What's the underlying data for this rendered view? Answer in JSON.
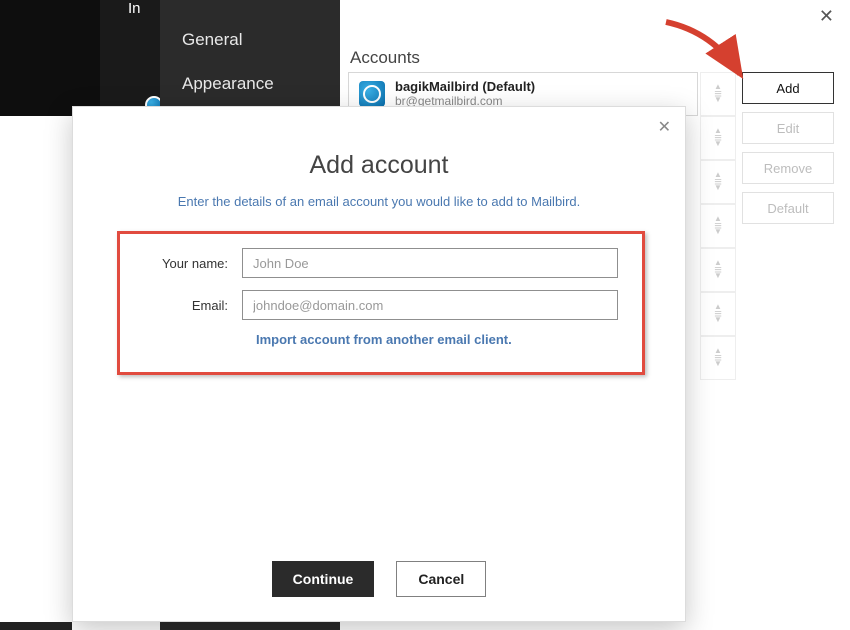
{
  "topbar": {
    "truncated_text": "In"
  },
  "sidebar": {
    "items": [
      {
        "label": "General"
      },
      {
        "label": "Appearance"
      }
    ]
  },
  "accounts": {
    "heading": "Accounts",
    "list": [
      {
        "name": "bagikMailbird (Default)",
        "email": "br@getmailbird.com"
      }
    ]
  },
  "side_buttons": {
    "add": "Add",
    "edit": "Edit",
    "remove": "Remove",
    "default": "Default"
  },
  "modal": {
    "title": "Add account",
    "subtitle": "Enter the details of an email account you would like to add to Mailbird.",
    "name_label": "Your name:",
    "name_placeholder": "John Doe",
    "name_value": "",
    "email_label": "Email:",
    "email_placeholder": "johndoe@domain.com",
    "email_value": "",
    "import_link": "Import account from another email client.",
    "continue": "Continue",
    "cancel": "Cancel"
  },
  "annotation": {
    "arrow_color": "#d5402f"
  }
}
